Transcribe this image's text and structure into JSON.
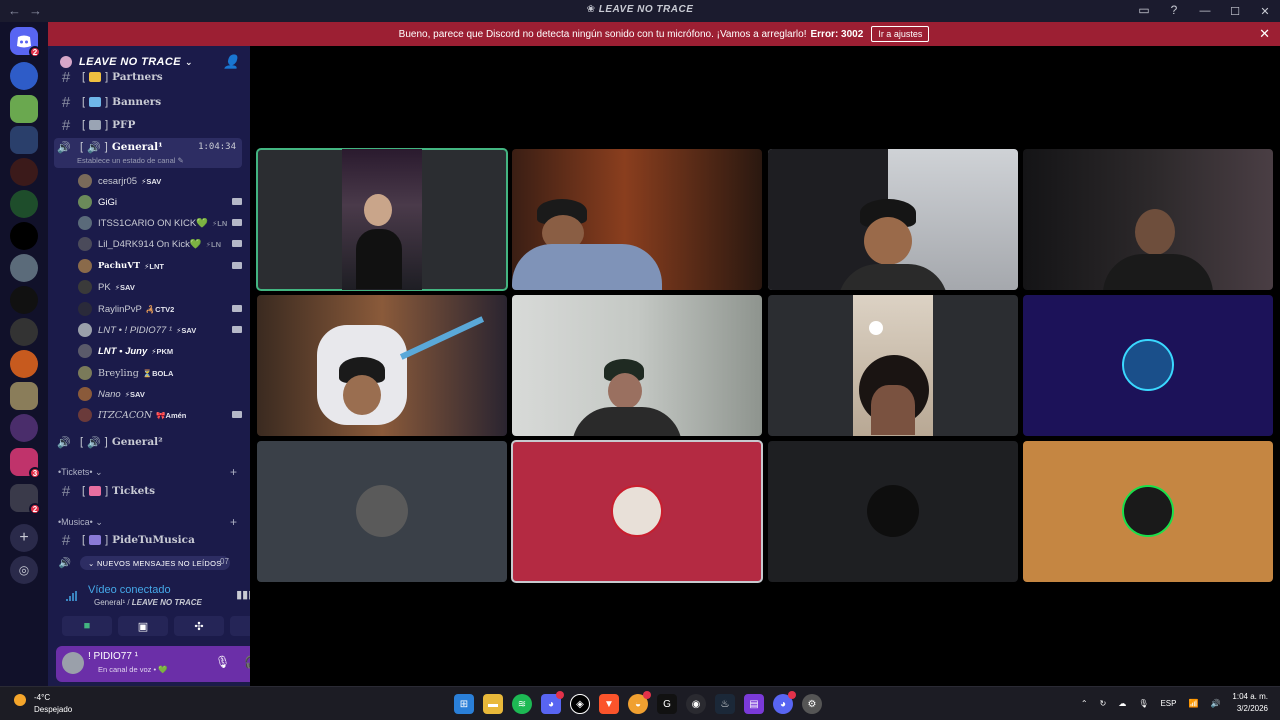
{
  "window": {
    "title": "LEAVE NO TRACE"
  },
  "banner": {
    "message": "Bueno, parece que Discord no detecta ningún sonido con tu micrófono. ¡Vamos a arreglarlo!",
    "error": "Error: 3002",
    "button": "Ir a ajustes"
  },
  "rail": {
    "badges": [
      "2",
      "3",
      "2"
    ]
  },
  "server": {
    "name": "LEAVE NO TRACE",
    "channels": [
      {
        "name": "Partners",
        "type": "text"
      },
      {
        "name": "Banners",
        "type": "text"
      },
      {
        "name": "PFP",
        "type": "text"
      }
    ],
    "active_voice": {
      "name": "General¹",
      "timer": "1:04:34",
      "status_hint": "Establece un estado de canal"
    },
    "members": [
      {
        "name": "cesarjr05",
        "tag": "⚡SAV",
        "cam": false
      },
      {
        "name": "GiGi",
        "tag": "",
        "cam": true
      },
      {
        "name": "ITSS1CARIO ON KICK💚",
        "tag": "⚡LN",
        "cam": true
      },
      {
        "name": "Lil_D4RK914 On Kick💚",
        "tag": "⚡LN",
        "cam": true
      },
      {
        "name": "PachuVT",
        "tag": "⚡LNT",
        "cam": true
      },
      {
        "name": "PK",
        "tag": "⚡SAV",
        "cam": false
      },
      {
        "name": "RaylinPvP",
        "tag": "🦂CTV2",
        "cam": true
      },
      {
        "name": "LNT • ! PIDIO77 ¹",
        "tag": "⚡SAV",
        "cam": true
      },
      {
        "name": "LNT • Juny",
        "tag": "⚡PKM",
        "cam": false
      },
      {
        "name": "Breyling",
        "tag": "⏳BOLA",
        "cam": false
      },
      {
        "name": "Nano",
        "tag": "⚡SAV",
        "cam": false
      },
      {
        "name": "ITZCACON",
        "tag": "🎀Amén",
        "cam": true
      }
    ],
    "voice2": "General²",
    "categories": [
      {
        "name": "•Tickets•",
        "channel": "Tickets"
      },
      {
        "name": "•Musica•",
        "channel": "PideTuMusica"
      }
    ],
    "unread_pill": "NUEVOS MENSAJES NO LEÍDOS",
    "unread_num": "07"
  },
  "voice": {
    "title": "Vídeo conectado",
    "subtitle_channel": "General¹",
    "subtitle_server": "LEAVE NO TRACE"
  },
  "user": {
    "name": "! PIDIO77 ¹",
    "status": "En canal de voz • 💚"
  },
  "taskbar": {
    "temp": "-4°C",
    "weather": "Despejado",
    "lang": "ESP",
    "time": "1:04 a. m.",
    "date": "3/2/2026"
  },
  "colors": {
    "accent": "#5865f2",
    "banner": "#9c1f33",
    "sidebar": "#1b1b4a",
    "speaking": "#43b581"
  }
}
